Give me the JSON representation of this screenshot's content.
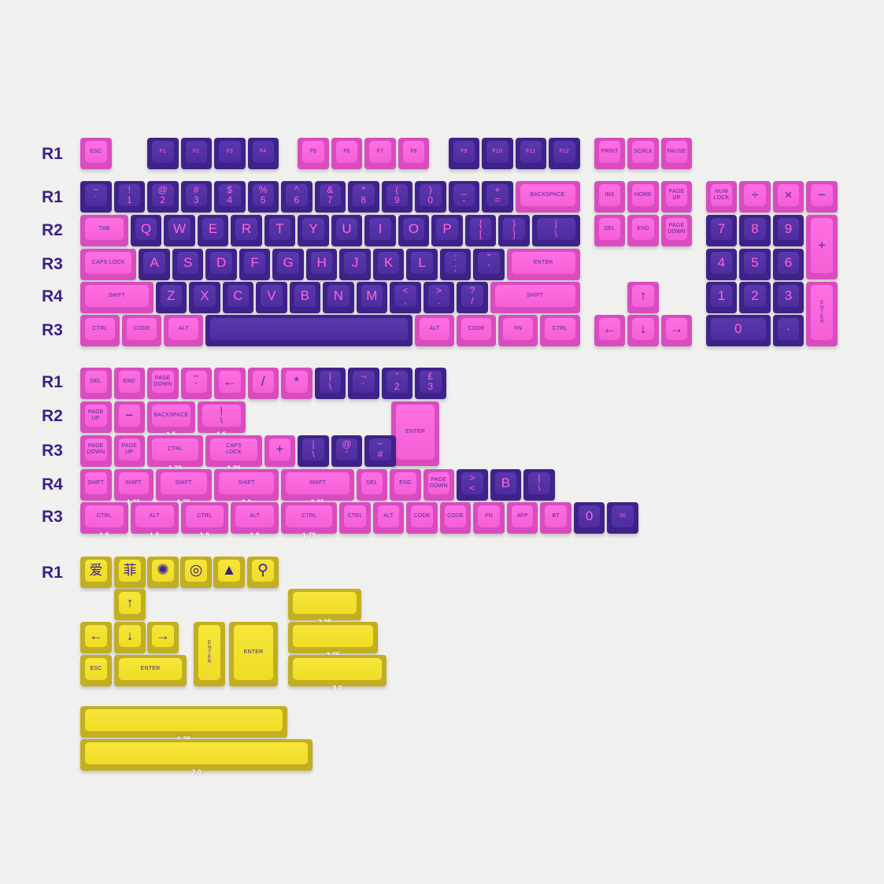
{
  "colors": {
    "pink": "#f55fd6",
    "purple": "#4d2d9f",
    "yellow": "#efdc25",
    "label": "#3a1f8c",
    "background": "#f0f0ef"
  },
  "row_labels": [
    "R1",
    "R1",
    "R2",
    "R3",
    "R4",
    "R3",
    "R1",
    "R2",
    "R3",
    "R4",
    "R3",
    "R1"
  ],
  "main": {
    "keys": [
      {
        "t": "ESC",
        "c": "pink"
      },
      {
        "t": "F1",
        "c": "purple"
      },
      {
        "t": "F2",
        "c": "purple"
      },
      {
        "t": "F3",
        "c": "purple"
      },
      {
        "t": "F4",
        "c": "purple"
      },
      {
        "t": "F5",
        "c": "pink"
      },
      {
        "t": "F6",
        "c": "pink"
      },
      {
        "t": "F7",
        "c": "pink"
      },
      {
        "t": "F8",
        "c": "pink"
      },
      {
        "t": "F9",
        "c": "purple"
      },
      {
        "t": "F10",
        "c": "purple"
      },
      {
        "t": "F11",
        "c": "purple"
      },
      {
        "t": "F12",
        "c": "purple"
      },
      {
        "t": "PRINT",
        "c": "pink"
      },
      {
        "t": "SCRLK",
        "c": "pink"
      },
      {
        "t": "PAUSE",
        "c": "pink"
      },
      {
        "t": "~",
        "b": "`",
        "c": "purple"
      },
      {
        "t": "!",
        "b": "1",
        "c": "purple"
      },
      {
        "t": "@",
        "b": "2",
        "c": "purple"
      },
      {
        "t": "#",
        "b": "3",
        "c": "purple"
      },
      {
        "t": "$",
        "b": "4",
        "c": "purple"
      },
      {
        "t": "%",
        "b": "5",
        "c": "purple"
      },
      {
        "t": "^",
        "b": "6",
        "c": "purple"
      },
      {
        "t": "&",
        "b": "7",
        "c": "purple"
      },
      {
        "t": "*",
        "b": "8",
        "c": "purple"
      },
      {
        "t": "(",
        "b": "9",
        "c": "purple"
      },
      {
        "t": ")",
        "b": "0",
        "c": "purple"
      },
      {
        "t": "_",
        "b": "-",
        "c": "purple"
      },
      {
        "t": "+",
        "b": "=",
        "c": "purple"
      },
      {
        "t": "BACKSPACE",
        "c": "pink"
      },
      {
        "t": "INS",
        "c": "pink"
      },
      {
        "t": "HOME",
        "c": "pink"
      },
      {
        "t": "PAGE",
        "b": "UP",
        "c": "pink"
      },
      {
        "t": "NUM",
        "b": "LOCK",
        "c": "pink"
      },
      {
        "t": "÷",
        "c": "pink"
      },
      {
        "t": "×",
        "c": "pink"
      },
      {
        "t": "−",
        "c": "pink"
      },
      {
        "t": "TAB",
        "c": "pink"
      },
      {
        "t": "Q",
        "c": "purple"
      },
      {
        "t": "W",
        "c": "purple"
      },
      {
        "t": "E",
        "c": "purple"
      },
      {
        "t": "R",
        "c": "purple"
      },
      {
        "t": "T",
        "c": "purple"
      },
      {
        "t": "Y",
        "c": "purple"
      },
      {
        "t": "U",
        "c": "purple"
      },
      {
        "t": "I",
        "c": "purple"
      },
      {
        "t": "O",
        "c": "purple"
      },
      {
        "t": "P",
        "c": "purple"
      },
      {
        "t": "{",
        "b": "[",
        "c": "purple"
      },
      {
        "t": "}",
        "b": "]",
        "c": "purple"
      },
      {
        "t": "|",
        "b": "\\",
        "c": "purple"
      },
      {
        "t": "DEL",
        "c": "pink"
      },
      {
        "t": "END",
        "c": "pink"
      },
      {
        "t": "PAGE",
        "b": "DOWN",
        "c": "pink"
      },
      {
        "t": "7",
        "c": "purple"
      },
      {
        "t": "8",
        "c": "purple"
      },
      {
        "t": "9",
        "c": "purple"
      },
      {
        "t": "+",
        "c": "pink"
      },
      {
        "t": "CAPS LOCK",
        "c": "pink"
      },
      {
        "t": "A",
        "c": "purple"
      },
      {
        "t": "S",
        "c": "purple"
      },
      {
        "t": "D",
        "c": "purple"
      },
      {
        "t": "F",
        "c": "purple"
      },
      {
        "t": "G",
        "c": "purple"
      },
      {
        "t": "H",
        "c": "purple"
      },
      {
        "t": "J",
        "c": "purple"
      },
      {
        "t": "K",
        "c": "purple"
      },
      {
        "t": "L",
        "c": "purple"
      },
      {
        "t": ":",
        "b": ";",
        "c": "purple"
      },
      {
        "t": "\"",
        "b": "'",
        "c": "purple"
      },
      {
        "t": "ENTER",
        "c": "pink"
      },
      {
        "t": "4",
        "c": "purple"
      },
      {
        "t": "5",
        "c": "purple"
      },
      {
        "t": "6",
        "c": "purple"
      },
      {
        "t": "SHIFT",
        "c": "pink"
      },
      {
        "t": "Z",
        "c": "purple"
      },
      {
        "t": "X",
        "c": "purple"
      },
      {
        "t": "C",
        "c": "purple"
      },
      {
        "t": "V",
        "c": "purple"
      },
      {
        "t": "B",
        "c": "purple"
      },
      {
        "t": "N",
        "c": "purple"
      },
      {
        "t": "M",
        "c": "purple"
      },
      {
        "t": "<",
        "b": ",",
        "c": "purple"
      },
      {
        "t": ">",
        "b": ".",
        "c": "purple"
      },
      {
        "t": "?",
        "b": "/",
        "c": "purple"
      },
      {
        "t": "SHIFT",
        "c": "pink"
      },
      {
        "t": "↑",
        "c": "pink"
      },
      {
        "t": "1",
        "c": "purple"
      },
      {
        "t": "2",
        "c": "purple"
      },
      {
        "t": "3",
        "c": "purple"
      },
      {
        "t": "ENTER",
        "c": "pink",
        "v": true
      },
      {
        "t": "CTRL",
        "c": "pink"
      },
      {
        "t": "CODE",
        "c": "pink"
      },
      {
        "t": "ALT",
        "c": "pink"
      },
      {
        "t": "",
        "c": "purple"
      },
      {
        "t": "ALT",
        "c": "pink"
      },
      {
        "t": "CODE",
        "c": "pink"
      },
      {
        "t": "FN",
        "c": "pink"
      },
      {
        "t": "CTRL",
        "c": "pink"
      },
      {
        "t": "←",
        "c": "pink"
      },
      {
        "t": "↓",
        "c": "pink"
      },
      {
        "t": "→",
        "c": "pink"
      },
      {
        "t": "0",
        "c": "purple"
      },
      {
        "t": "·",
        "c": "purple"
      }
    ]
  },
  "mods": {
    "keys": [
      {
        "t": "DEL",
        "c": "pink"
      },
      {
        "t": "END",
        "c": "pink"
      },
      {
        "t": "PAGE",
        "b": "DOWN",
        "c": "pink"
      },
      {
        "t": "~",
        "b": "`",
        "c": "pink"
      },
      {
        "t": "←",
        "c": "pink"
      },
      {
        "t": "/",
        "c": "pink"
      },
      {
        "t": "*",
        "c": "pink"
      },
      {
        "t": "|",
        "b": "\\",
        "c": "purple"
      },
      {
        "t": "¬",
        "b": "`",
        "c": "purple"
      },
      {
        "t": "\"",
        "b": "2",
        "c": "purple"
      },
      {
        "t": "£",
        "b": "3",
        "c": "purple"
      },
      {
        "t": "PAGE",
        "b": "UP",
        "c": "pink"
      },
      {
        "t": "−",
        "c": "pink"
      },
      {
        "t": "BACKSPACE",
        "c": "pink",
        "s": "1.5"
      },
      {
        "t": "|",
        "b": "\\",
        "c": "pink",
        "s": "1.5"
      },
      {
        "t": "ENTER",
        "c": "pink"
      },
      {
        "t": "PAGE",
        "b": "DOWN",
        "c": "pink"
      },
      {
        "t": "PAGE",
        "b": "UP",
        "c": "pink"
      },
      {
        "t": "CTRL",
        "c": "pink",
        "s": "1.75"
      },
      {
        "t": "CAPS",
        "b": "LOCK",
        "c": "pink",
        "s": "1.75"
      },
      {
        "t": "+",
        "c": "pink"
      },
      {
        "t": "|",
        "b": "\\",
        "c": "purple"
      },
      {
        "t": "@",
        "b": "'",
        "c": "purple"
      },
      {
        "t": "~",
        "b": "#",
        "c": "purple"
      },
      {
        "t": "SHIFT",
        "c": "pink"
      },
      {
        "t": "SHIFT",
        "c": "pink",
        "s": "1.25"
      },
      {
        "t": "SHIFT",
        "c": "pink",
        "s": "1.75"
      },
      {
        "t": "SHIFT",
        "c": "pink",
        "s": "2.0"
      },
      {
        "t": "SHIFT",
        "c": "pink",
        "s": "2.25"
      },
      {
        "t": "DEL",
        "c": "pink"
      },
      {
        "t": "END",
        "c": "pink"
      },
      {
        "t": "PAGE",
        "b": "DOWN",
        "c": "pink"
      },
      {
        "t": ">",
        "b": "<",
        "c": "purple"
      },
      {
        "t": "B",
        "c": "purple"
      },
      {
        "t": "|",
        "b": "\\",
        "c": "purple"
      },
      {
        "t": "CTRL",
        "c": "pink",
        "s": "1.5"
      },
      {
        "t": "ALT",
        "c": "pink",
        "s": "1.5"
      },
      {
        "t": "CTRL",
        "c": "pink",
        "s": "1.5"
      },
      {
        "t": "ALT",
        "c": "pink",
        "s": "1.5"
      },
      {
        "t": "CTRL",
        "c": "pink",
        "s": "1.75"
      },
      {
        "t": "CTRL",
        "c": "pink"
      },
      {
        "t": "ALT",
        "c": "pink"
      },
      {
        "t": "CODE",
        "c": "pink"
      },
      {
        "t": "CODE",
        "c": "pink"
      },
      {
        "t": "FN",
        "c": "pink"
      },
      {
        "t": "APP",
        "c": "pink"
      },
      {
        "t": "BT",
        "c": "pink"
      },
      {
        "t": "0",
        "c": "purple"
      },
      {
        "t": "00",
        "c": "purple"
      }
    ]
  },
  "yellow": {
    "keys": [
      {
        "t": "爱",
        "c": "yellow"
      },
      {
        "t": "菲",
        "c": "yellow"
      },
      {
        "icon": "fan-icon",
        "g": "✺",
        "c": "yellow"
      },
      {
        "icon": "target-icon",
        "g": "◎",
        "c": "yellow"
      },
      {
        "icon": "pyramid-icon",
        "g": "▲",
        "c": "yellow"
      },
      {
        "icon": "robot-arm-icon",
        "g": "⚲",
        "c": "yellow"
      },
      {
        "t": "↑",
        "c": "yellow"
      },
      {
        "t": "←",
        "c": "yellow"
      },
      {
        "t": "↓",
        "c": "yellow"
      },
      {
        "t": "→",
        "c": "yellow"
      },
      {
        "t": "ESC",
        "c": "yellow"
      },
      {
        "t": "ENTER",
        "c": "yellow"
      },
      {
        "t": "ENTER",
        "c": "yellow",
        "v": true
      },
      {
        "t": "ENTER",
        "c": "yellow"
      },
      {
        "t": "",
        "c": "yellow",
        "s": "2.25"
      },
      {
        "t": "",
        "c": "yellow",
        "s": "2.75"
      },
      {
        "t": "",
        "c": "yellow",
        "s": "3.0"
      },
      {
        "t": "",
        "c": "yellow",
        "s": "6.25"
      },
      {
        "t": "",
        "c": "yellow",
        "s": "7.0"
      }
    ]
  }
}
